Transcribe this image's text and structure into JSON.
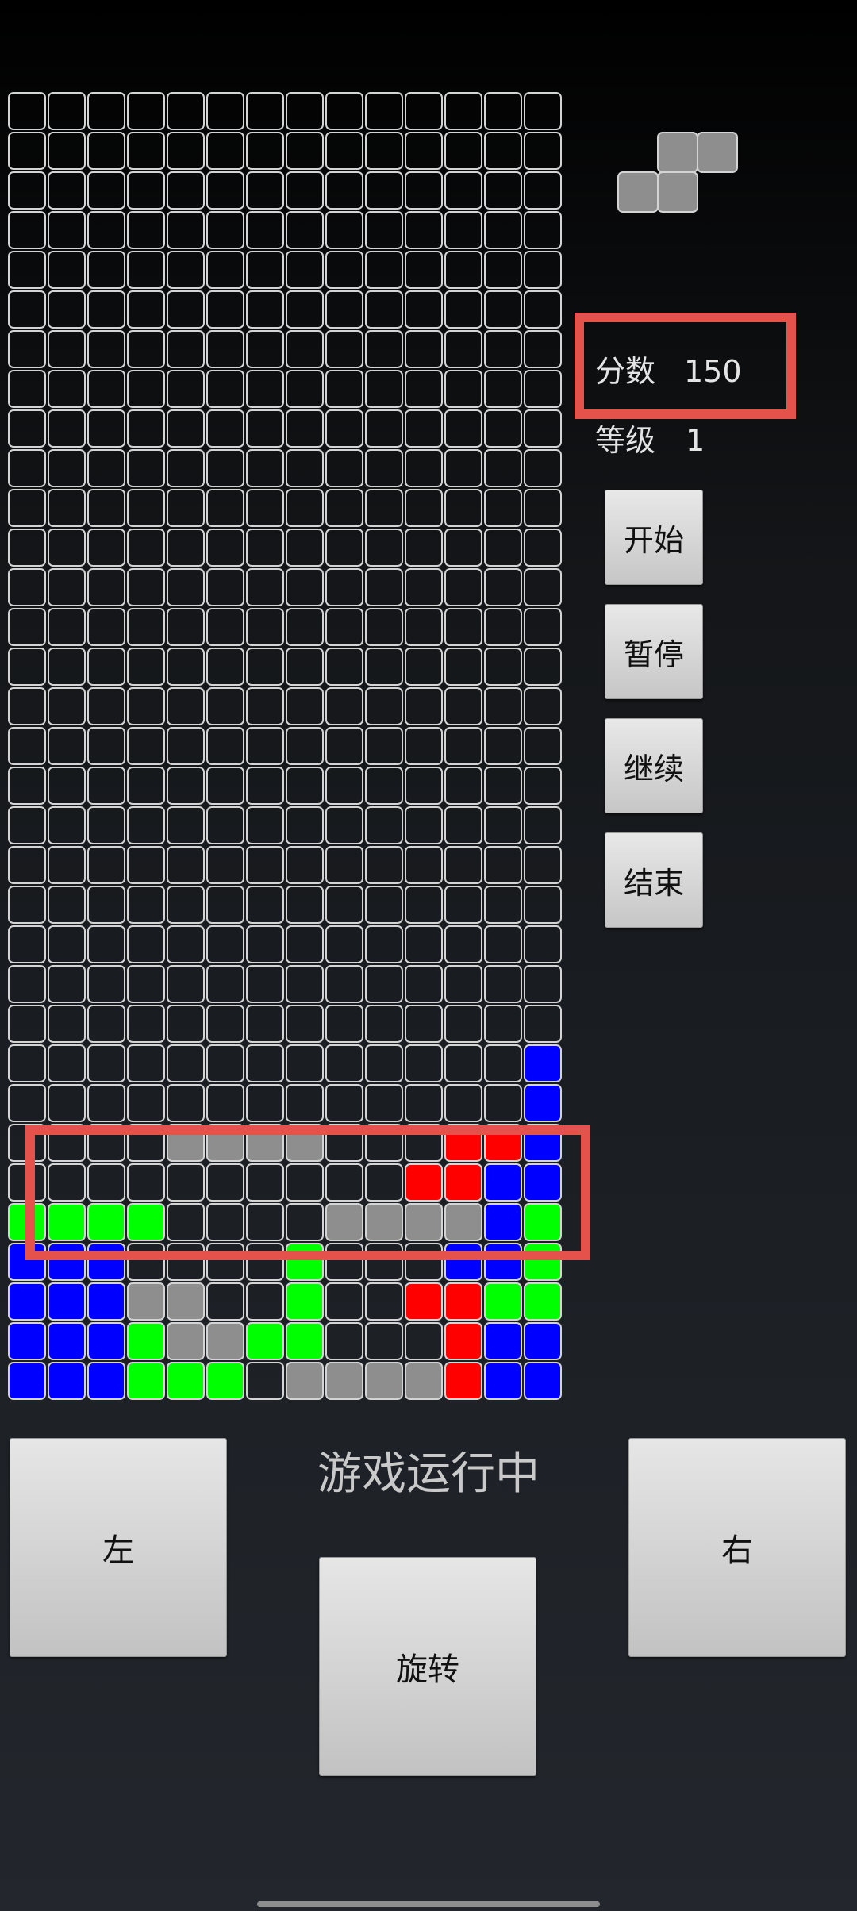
{
  "board": {
    "columns": 14,
    "rows": 33,
    "colors": {
      "empty": "transparent",
      "gray": "#8e8e8e",
      "red": "#ff0000",
      "blue": "#0000ff",
      "green": "#00ff00",
      "border": "#d4d4d4"
    },
    "filled_rows": [
      "..............",
      "..............",
      "..............",
      "..............",
      "..............",
      "..............",
      "..............",
      "..............",
      "..............",
      "..............",
      "..............",
      "..............",
      "..............",
      "..............",
      "..............",
      "..............",
      "..............",
      "..............",
      "..............",
      "..............",
      "..............",
      "..............",
      "..............",
      "..............",
      ".............B",
      ".............B",
      "....GGGG...RRB",
      "..........RRBB",
      "gggg....GGGGBg",
      "BBB....g...BBg",
      "BBBGG..g..RRgg",
      "BBBgGGgg...RBB",
      "BBBggg.GGGGRBB"
    ]
  },
  "preview": {
    "rows": [
      ".XX",
      "XX."
    ],
    "color": "#8e8e8e"
  },
  "score": {
    "label": "分数",
    "value": "150"
  },
  "level": {
    "label": "等级",
    "value": "1"
  },
  "buttons": {
    "start": "开始",
    "pause": "暂停",
    "resume": "继续",
    "end": "结束",
    "left": "左",
    "right": "右",
    "rotate": "旋转"
  },
  "status": "游戏运行中",
  "highlight_color": "#e5524c"
}
